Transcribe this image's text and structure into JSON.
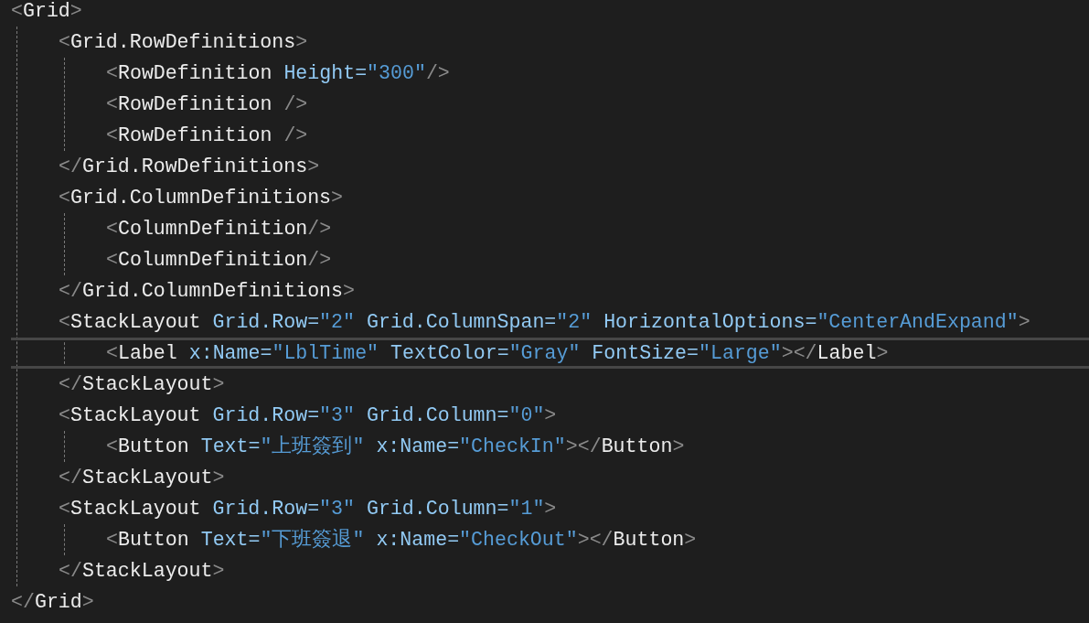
{
  "editor": {
    "root": {
      "open": [
        {
          "kind": "punct",
          "text": "<"
        },
        {
          "kind": "tag",
          "text": "Grid"
        },
        {
          "kind": "punct",
          "text": ">"
        }
      ],
      "current": false,
      "close": [
        {
          "kind": "punct",
          "text": "</"
        },
        {
          "kind": "tag",
          "text": "Grid"
        },
        {
          "kind": "punct",
          "text": ">"
        }
      ],
      "children": [
        {
          "open": [
            {
              "kind": "punct",
              "text": "<"
            },
            {
              "kind": "tag",
              "text": "Grid.RowDefinitions"
            },
            {
              "kind": "punct",
              "text": ">"
            }
          ],
          "current": false,
          "close": [
            {
              "kind": "punct",
              "text": "</"
            },
            {
              "kind": "tag",
              "text": "Grid.RowDefinitions"
            },
            {
              "kind": "punct",
              "text": ">"
            }
          ],
          "children": [
            {
              "open": [
                {
                  "kind": "punct",
                  "text": "<"
                },
                {
                  "kind": "tag",
                  "text": "RowDefinition"
                },
                {
                  "kind": "attr",
                  "text": " Height="
                },
                {
                  "kind": "value",
                  "text": "\"300\""
                },
                {
                  "kind": "punct",
                  "text": "/>"
                }
              ],
              "current": false
            },
            {
              "open": [
                {
                  "kind": "punct",
                  "text": "<"
                },
                {
                  "kind": "tag",
                  "text": "RowDefinition"
                },
                {
                  "kind": "punct",
                  "text": " />"
                }
              ],
              "current": false
            },
            {
              "open": [
                {
                  "kind": "punct",
                  "text": "<"
                },
                {
                  "kind": "tag",
                  "text": "RowDefinition"
                },
                {
                  "kind": "punct",
                  "text": " />"
                }
              ],
              "current": false
            }
          ]
        },
        {
          "open": [
            {
              "kind": "punct",
              "text": "<"
            },
            {
              "kind": "tag",
              "text": "Grid.ColumnDefinitions"
            },
            {
              "kind": "punct",
              "text": ">"
            }
          ],
          "current": false,
          "close": [
            {
              "kind": "punct",
              "text": "</"
            },
            {
              "kind": "tag",
              "text": "Grid.ColumnDefinitions"
            },
            {
              "kind": "punct",
              "text": ">"
            }
          ],
          "children": [
            {
              "open": [
                {
                  "kind": "punct",
                  "text": "<"
                },
                {
                  "kind": "tag",
                  "text": "ColumnDefinition"
                },
                {
                  "kind": "punct",
                  "text": "/>"
                }
              ],
              "current": false
            },
            {
              "open": [
                {
                  "kind": "punct",
                  "text": "<"
                },
                {
                  "kind": "tag",
                  "text": "ColumnDefinition"
                },
                {
                  "kind": "punct",
                  "text": "/>"
                }
              ],
              "current": false
            }
          ]
        },
        {
          "open": [
            {
              "kind": "punct",
              "text": "<"
            },
            {
              "kind": "tag",
              "text": "StackLayout"
            },
            {
              "kind": "attr",
              "text": " Grid.Row="
            },
            {
              "kind": "value",
              "text": "\"2\""
            },
            {
              "kind": "attr",
              "text": " Grid.ColumnSpan="
            },
            {
              "kind": "value",
              "text": "\"2\""
            },
            {
              "kind": "attr",
              "text": " HorizontalOptions="
            },
            {
              "kind": "value",
              "text": "\"CenterAndExpand\""
            },
            {
              "kind": "punct",
              "text": ">"
            }
          ],
          "current": false,
          "close": [
            {
              "kind": "punct",
              "text": "</"
            },
            {
              "kind": "tag",
              "text": "StackLayout"
            },
            {
              "kind": "punct",
              "text": ">"
            }
          ],
          "children": [
            {
              "open": [
                {
                  "kind": "punct",
                  "text": "<"
                },
                {
                  "kind": "tag",
                  "text": "Label"
                },
                {
                  "kind": "attr",
                  "text": " x:Name="
                },
                {
                  "kind": "value",
                  "text": "\"LblTime\""
                },
                {
                  "kind": "attr",
                  "text": " TextColor="
                },
                {
                  "kind": "value",
                  "text": "\"Gray\""
                },
                {
                  "kind": "attr",
                  "text": " FontSize="
                },
                {
                  "kind": "value",
                  "text": "\"Large\""
                },
                {
                  "kind": "punct",
                  "text": "></"
                },
                {
                  "kind": "tag",
                  "text": "Label"
                },
                {
                  "kind": "punct",
                  "text": ">"
                }
              ],
              "current": true
            }
          ]
        },
        {
          "open": [
            {
              "kind": "punct",
              "text": "<"
            },
            {
              "kind": "tag",
              "text": "StackLayout"
            },
            {
              "kind": "attr",
              "text": " Grid.Row="
            },
            {
              "kind": "value",
              "text": "\"3\""
            },
            {
              "kind": "attr",
              "text": " Grid.Column="
            },
            {
              "kind": "value",
              "text": "\"0\""
            },
            {
              "kind": "punct",
              "text": ">"
            }
          ],
          "current": false,
          "close": [
            {
              "kind": "punct",
              "text": "</"
            },
            {
              "kind": "tag",
              "text": "StackLayout"
            },
            {
              "kind": "punct",
              "text": ">"
            }
          ],
          "children": [
            {
              "open": [
                {
                  "kind": "punct",
                  "text": "<"
                },
                {
                  "kind": "tag",
                  "text": "Button"
                },
                {
                  "kind": "attr",
                  "text": " Text="
                },
                {
                  "kind": "value",
                  "text": "\"上班簽到\""
                },
                {
                  "kind": "attr",
                  "text": " x:Name="
                },
                {
                  "kind": "value",
                  "text": "\"CheckIn\""
                },
                {
                  "kind": "punct",
                  "text": "></"
                },
                {
                  "kind": "tag",
                  "text": "Button"
                },
                {
                  "kind": "punct",
                  "text": ">"
                }
              ],
              "current": false
            }
          ]
        },
        {
          "open": [
            {
              "kind": "punct",
              "text": "<"
            },
            {
              "kind": "tag",
              "text": "StackLayout"
            },
            {
              "kind": "attr",
              "text": " Grid.Row="
            },
            {
              "kind": "value",
              "text": "\"3\""
            },
            {
              "kind": "attr",
              "text": " Grid.Column="
            },
            {
              "kind": "value",
              "text": "\"1\""
            },
            {
              "kind": "punct",
              "text": ">"
            }
          ],
          "current": false,
          "close": [
            {
              "kind": "punct",
              "text": "</"
            },
            {
              "kind": "tag",
              "text": "StackLayout"
            },
            {
              "kind": "punct",
              "text": ">"
            }
          ],
          "children": [
            {
              "open": [
                {
                  "kind": "punct",
                  "text": "<"
                },
                {
                  "kind": "tag",
                  "text": "Button"
                },
                {
                  "kind": "attr",
                  "text": " Text="
                },
                {
                  "kind": "value",
                  "text": "\"下班簽退\""
                },
                {
                  "kind": "attr",
                  "text": " x:Name="
                },
                {
                  "kind": "value",
                  "text": "\"CheckOut\""
                },
                {
                  "kind": "punct",
                  "text": "></"
                },
                {
                  "kind": "tag",
                  "text": "Button"
                },
                {
                  "kind": "punct",
                  "text": ">"
                }
              ],
              "current": false
            }
          ]
        }
      ]
    }
  }
}
